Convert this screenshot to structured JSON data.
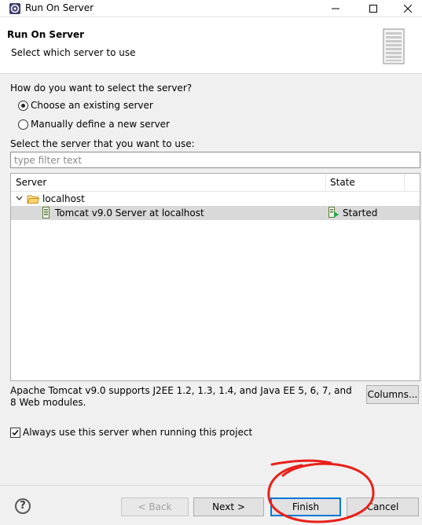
{
  "window": {
    "title": "Run On Server",
    "minimize_icon": "minimize-icon",
    "maximize_icon": "maximize-icon",
    "close_icon": "close-icon"
  },
  "banner": {
    "title": "Run On Server",
    "subtitle": "Select which server to use",
    "icon": "server-icon"
  },
  "selection": {
    "question": "How do you want to select the server?",
    "options": [
      {
        "label": "Choose an existing server",
        "selected": true
      },
      {
        "label": "Manually define a new server",
        "selected": false
      }
    ]
  },
  "server_list": {
    "label": "Select the server that you want to use:",
    "filter_placeholder": "type filter text",
    "columns": [
      "Server",
      "State"
    ],
    "rows": [
      {
        "name": "localhost",
        "type": "folder",
        "expanded": true,
        "state": ""
      },
      {
        "name": "Tomcat v9.0 Server at localhost",
        "type": "server",
        "state": "Started",
        "selected": true
      }
    ]
  },
  "description": "Apache Tomcat v9.0 supports J2EE 1.2, 1.3, 1.4, and Java EE 5, 6, 7, and 8 Web modules.",
  "columns_button": "Columns...",
  "always_use": {
    "label": "Always use this server when running this project",
    "checked": true
  },
  "buttons": {
    "help": "?",
    "back": "< Back",
    "next": "Next >",
    "finish": "Finish",
    "cancel": "Cancel"
  },
  "colors": {
    "focus_border": "#0078d7",
    "annotation": "#e8201a",
    "selection_bg": "#d9d9d9",
    "dialog_bg": "#f0f0f0"
  }
}
